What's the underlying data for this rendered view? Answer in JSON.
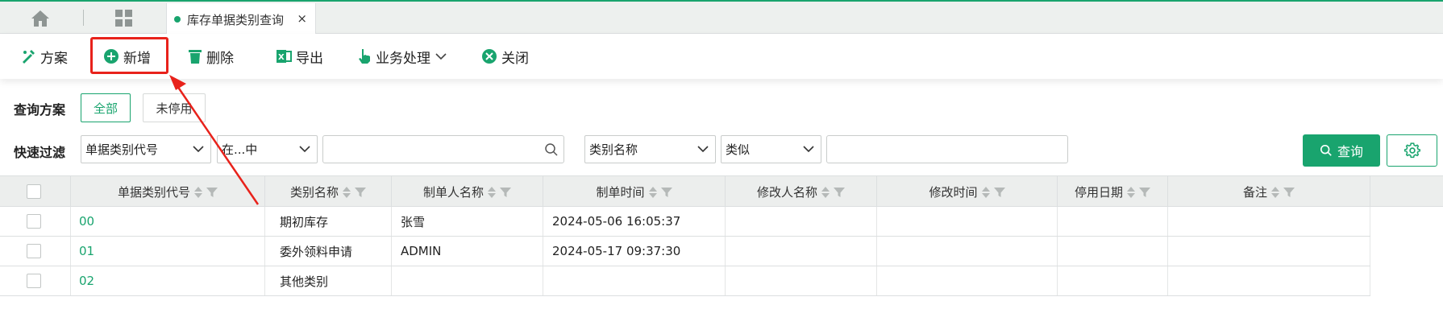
{
  "tabs": {
    "home_icon": "home-icon",
    "apps_icon": "grid-icon",
    "active_tab_label": "库存单据类别查询",
    "close_glyph": "×"
  },
  "toolbar": {
    "scheme": "方案",
    "add": "新增",
    "delete": "删除",
    "export": "导出",
    "business": "业务处理",
    "close": "关闭"
  },
  "query_scheme": {
    "label": "查询方案",
    "options": [
      "全部",
      "未停用"
    ],
    "selected": "全部"
  },
  "quick_filter": {
    "label": "快速过滤",
    "field1": "单据类别代号",
    "operator1": "在...中",
    "value1": "",
    "field2": "类别名称",
    "operator2": "类似",
    "value2": "",
    "query_button": "查询"
  },
  "table": {
    "columns": [
      "单据类别代号",
      "类别名称",
      "制单人名称",
      "制单时间",
      "修改人名称",
      "修改时间",
      "停用日期",
      "备注"
    ],
    "rows": [
      {
        "code": "00",
        "name": "期初库存",
        "creator": "张雪",
        "created": "2024-05-06 16:05:37",
        "modifier": "",
        "modified": "",
        "disabled": "",
        "remark": ""
      },
      {
        "code": "01",
        "name": "委外领料申请",
        "creator": "ADMIN",
        "created": "2024-05-17 09:37:30",
        "modifier": "",
        "modified": "",
        "disabled": "",
        "remark": ""
      },
      {
        "code": "02",
        "name": "其他类别",
        "creator": "",
        "created": "",
        "modifier": "",
        "modified": "",
        "disabled": "",
        "remark": ""
      }
    ]
  },
  "colors": {
    "accent": "#19a46e",
    "highlight": "#e8221b"
  }
}
